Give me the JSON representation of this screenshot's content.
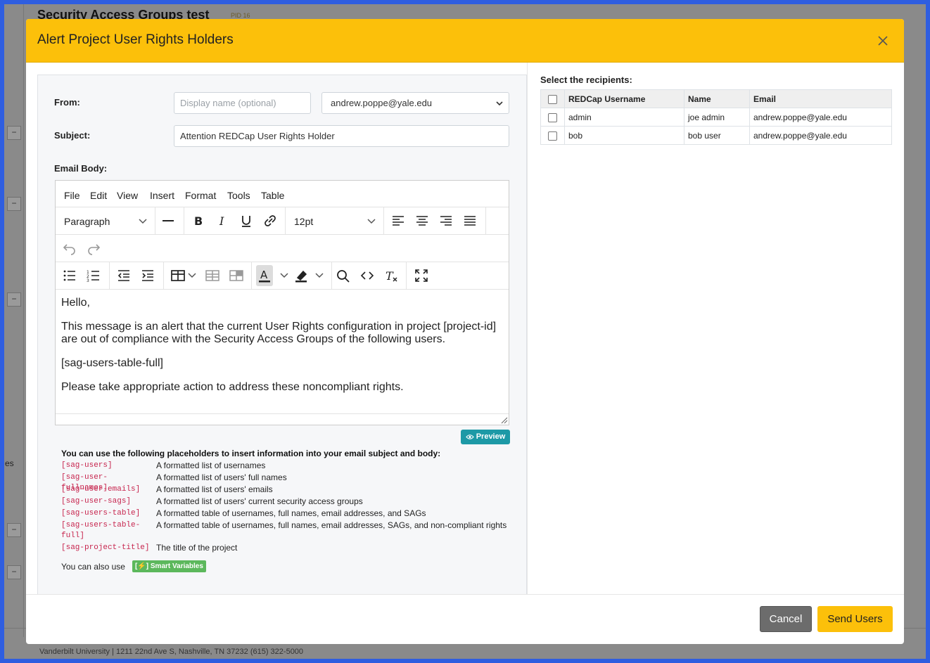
{
  "background": {
    "page_title": "Security Access Groups test",
    "pid": "PID 16",
    "side_text": "es",
    "footer": "Vanderbilt University | 1211 22nd Ave S, Nashville, TN 37232 (615) 322-5000"
  },
  "modal": {
    "title": "Alert Project User Rights Holders",
    "from_label": "From:",
    "display_name_placeholder": "Display name (optional)",
    "from_email": "andrew.poppe@yale.edu",
    "subject_label": "Subject:",
    "subject_value": "Attention REDCap User Rights Holder",
    "email_body_label": "Email Body:",
    "editor": {
      "menu": [
        "File",
        "Edit",
        "View",
        "Insert",
        "Format",
        "Tools",
        "Table"
      ],
      "block_format": "Paragraph",
      "font_size": "12pt",
      "body": [
        "Hello,",
        "This message is an alert that the current User Rights configuration in project [project-id] are out of compliance with the Security Access Groups of the following users.",
        "[sag-users-table-full]",
        "Please take appropriate action to address these noncompliant rights."
      ]
    },
    "preview_label": "Preview",
    "placeholders_heading": "You can use the following placeholders to insert information into your email subject and body:",
    "placeholders": [
      {
        "code": "[sag-users]",
        "desc": "A formatted list of usernames"
      },
      {
        "code": "[sag-user-fullnames]",
        "desc": "A formatted list of users' full names"
      },
      {
        "code": "[sag-user-emails]",
        "desc": "A formatted list of users' emails"
      },
      {
        "code": "[sag-user-sags]",
        "desc": "A formatted list of users' current security access groups"
      },
      {
        "code": "[sag-users-table]",
        "desc": "A formatted table of usernames, full names, email addresses, and SAGs"
      },
      {
        "code": "[sag-users-table-full]",
        "desc": "A formatted table of usernames, full names, email addresses, SAGs, and non-compliant rights"
      },
      {
        "code": "[sag-project-title]",
        "desc": "The title of the project"
      }
    ],
    "also_text": "You can also use",
    "smart_variables_label": "[⚡] Smart Variables",
    "recipients": {
      "heading": "Select the recipients:",
      "columns": [
        "REDCap Username",
        "Name",
        "Email"
      ],
      "rows": [
        {
          "username": "admin",
          "name": "joe admin",
          "email": "andrew.poppe@yale.edu"
        },
        {
          "username": "bob",
          "name": "bob user",
          "email": "andrew.poppe@yale.edu"
        }
      ]
    },
    "cancel_label": "Cancel",
    "send_label": "Send Users"
  },
  "colors": {
    "header_bg": "#fcc00a",
    "send_bg": "#fcc00a",
    "cancel_bg": "#6c6c6c",
    "preview_bg": "#1d99a6",
    "smart_badge_bg": "#5cb85c",
    "placeholder_code": "#c7254e"
  }
}
